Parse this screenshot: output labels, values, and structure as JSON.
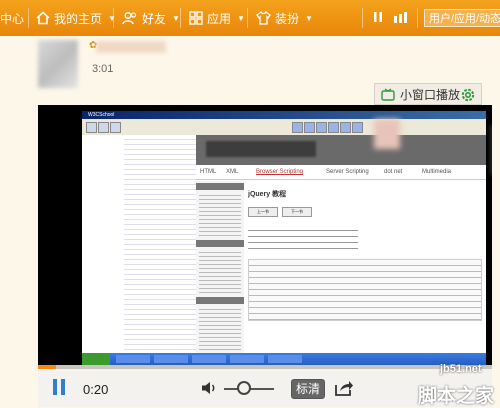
{
  "nav": {
    "left_partial": "中心",
    "home": "我的主页",
    "friends": "好友",
    "apps": "应用",
    "dress": "装扮",
    "search_placeholder": "用户/应用/动态"
  },
  "post": {
    "emoji": "✿",
    "time": "3:01"
  },
  "mini_player_label": "小窗口播放",
  "screen": {
    "window_title": "W3CSchool",
    "tabs": [
      "HTML",
      "XML",
      "Browser Scripting",
      "Server Scripting",
      "dot net",
      "Multimedia"
    ],
    "active_tab": "Browser Scripting",
    "page_title": "jQuery 教程",
    "prev_button": "上一节",
    "next_button": "下一节"
  },
  "player": {
    "time": "0:20",
    "quality": "标清",
    "progress": 0.04
  },
  "watermark": {
    "url": "jb51.net",
    "name": "脚本之家"
  },
  "colors": {
    "nav_bar": "#f09515",
    "accent": "#f28c16",
    "settings_icon": "#2e9b3b"
  }
}
